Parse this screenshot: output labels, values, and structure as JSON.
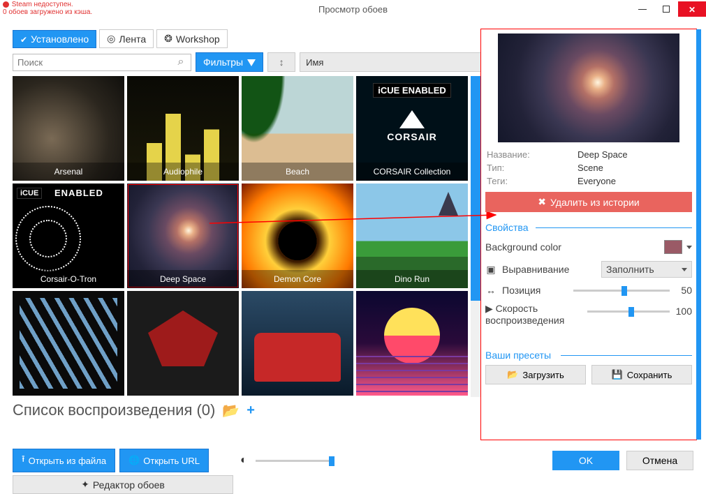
{
  "status": {
    "steam": "Steam недоступен.",
    "cache": "0 обоев загружено из кэша."
  },
  "window": {
    "title": "Просмотр обоев",
    "tabs": {
      "installed": "Установлено",
      "feed": "Лента",
      "workshop": "Workshop"
    }
  },
  "filter": {
    "search_placeholder": "Поиск",
    "filters_label": "Фильтры",
    "sort_label": "Имя"
  },
  "wallpapers": [
    {
      "name": "Arsenal"
    },
    {
      "name": "Audiophile"
    },
    {
      "name": "Beach"
    },
    {
      "name": "CORSAIR Collection"
    },
    {
      "name": "Corsair-O-Tron"
    },
    {
      "name": "Deep Space"
    },
    {
      "name": "Demon Core"
    },
    {
      "name": "Dino Run"
    },
    {
      "name": ""
    },
    {
      "name": ""
    },
    {
      "name": ""
    },
    {
      "name": ""
    }
  ],
  "cue": {
    "badge": "iCUE",
    "enabled": "ENABLED",
    "brand": "CORSAIR"
  },
  "side": {
    "meta": {
      "name_k": "Название:",
      "name_v": "Deep Space",
      "type_k": "Тип:",
      "type_v": "Scene",
      "tags_k": "Теги:",
      "tags_v": "Everyone"
    },
    "delete_label": "Удалить из истории",
    "props_header": "Свойства",
    "bgcolor_label": "Background color",
    "bgcolor_value": "#9a5a66",
    "align": {
      "label": "Выравнивание",
      "value": "Заполнить"
    },
    "position": {
      "label": "Позиция",
      "value": "50"
    },
    "speed": {
      "label1": "Скорость",
      "label2": "воспроизведения",
      "value": "100"
    },
    "presets_header": "Ваши пресеты",
    "load": "Загрузить",
    "save": "Сохранить"
  },
  "playlist": {
    "title": "Список воспроизведения (0)"
  },
  "actions": {
    "open_file": "Открыть из файла",
    "open_url": "Открыть URL",
    "editor": "Редактор обоев",
    "ok": "OK",
    "cancel": "Отмена"
  }
}
